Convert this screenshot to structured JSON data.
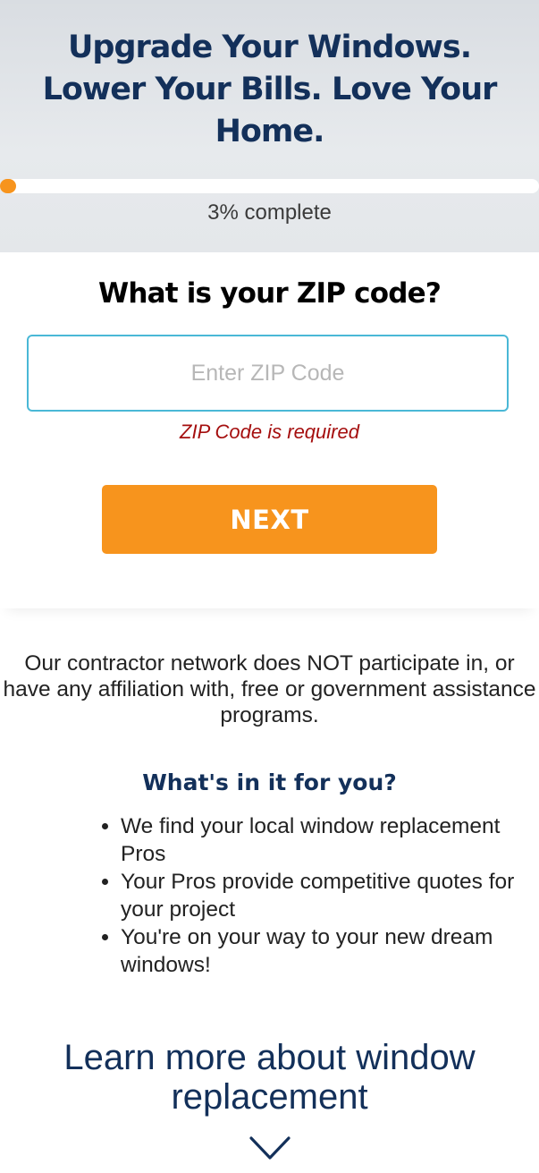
{
  "hero": {
    "title": "Upgrade Your Windows. Lower Your Bills. Love Your Home.",
    "progress_percent": 3,
    "progress_text": "3% complete"
  },
  "form": {
    "question": "What is your ZIP code?",
    "zip_placeholder": "Enter ZIP Code",
    "zip_value": "",
    "error": "ZIP Code is required",
    "next_label": "NEXT"
  },
  "disclaimer": "Our contractor network does NOT participate in, or have any affiliation with, free or government assistance programs.",
  "benefits": {
    "title": "What's in it for you?",
    "items": [
      "We find your local window replacement Pros",
      "Your Pros provide competitive quotes for your project",
      "You're on your way to your new dream windows!"
    ]
  },
  "learn_more": {
    "label": "Learn more about window replacement",
    "icon": "chevron-down-icon"
  },
  "colors": {
    "brand_navy": "#13305a",
    "accent_orange": "#f7941d",
    "input_border": "#4ab8d6",
    "error_red": "#a50f0f"
  }
}
